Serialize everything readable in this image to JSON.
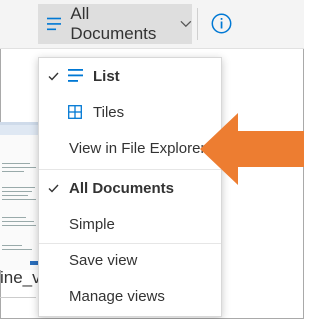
{
  "toolbar": {
    "view_label": "All Documents",
    "icons": {
      "view": "lines-icon",
      "dropdown": "chevron-down-icon",
      "info": "info-icon"
    }
  },
  "menu": {
    "items": [
      {
        "label": "List",
        "selected": true,
        "icon": "lines-icon"
      },
      {
        "label": "Tiles",
        "selected": false,
        "icon": "tiles-icon"
      },
      {
        "label": "View in File Explorer",
        "selected": false,
        "icon": ""
      },
      {
        "label": "All Documents",
        "selected": true,
        "icon": ""
      },
      {
        "label": "Simple",
        "selected": false,
        "icon": ""
      },
      {
        "label": "Save view",
        "selected": false,
        "icon": ""
      },
      {
        "label": "Manage views",
        "selected": false,
        "icon": ""
      }
    ]
  },
  "background": {
    "file_name_fragment": "ine_v."
  },
  "colors": {
    "accent": "#0078d4",
    "arrow": "#ed7d31",
    "selected_bg": "#dedede"
  }
}
